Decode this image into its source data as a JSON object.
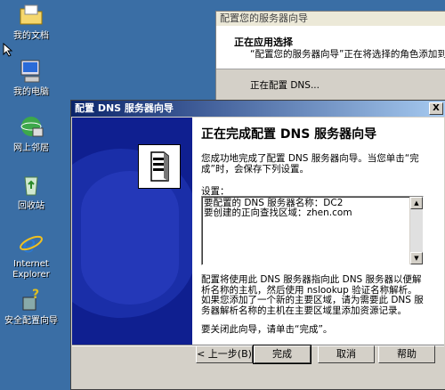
{
  "desktop": {
    "icons": [
      {
        "name": "my-documents",
        "label": "我的文档"
      },
      {
        "name": "my-computer",
        "label": "我的电脑"
      },
      {
        "name": "network",
        "label": "网上邻居"
      },
      {
        "name": "recycle-bin",
        "label": "回收站"
      },
      {
        "name": "internet-explorer",
        "label": "Internet Explorer"
      },
      {
        "name": "security-wizard",
        "label": "安全配置向导"
      }
    ]
  },
  "background_window": {
    "title": "配置您的服务器向导",
    "header_title": "正在应用选择",
    "header_subtitle": "“配置您的服务器向导”正在将选择的角色添加到",
    "progress_text": "正在配置 DNS..."
  },
  "dialog": {
    "title": "配置 DNS 服务器向导",
    "close_label": "X",
    "heading": "正在完成配置 DNS 服务器向导",
    "intro": "您成功地完成了配置 DNS 服务器向导。当您单击“完成”时，会保存下列设置。",
    "settings_label": "设置：",
    "settings_lines": [
      "要配置的 DNS 服务器名称：DC2",
      "要创建的正向查找区域：zhen.com"
    ],
    "info": "配置将使用此 DNS 服务器指向此 DNS 服务器以便解析名称的主机，然后使用 nslookup 验证名称解析。如果您添加了一个新的主要区域，请为需要此 DNS 服务器解析名称的主机在主要区域里添加资源记录。",
    "closing": "要关闭此向导，请单击“完成”。",
    "buttons": {
      "back": "< 上一步(B)",
      "finish": "完成",
      "cancel": "取消",
      "help": "帮助"
    }
  }
}
